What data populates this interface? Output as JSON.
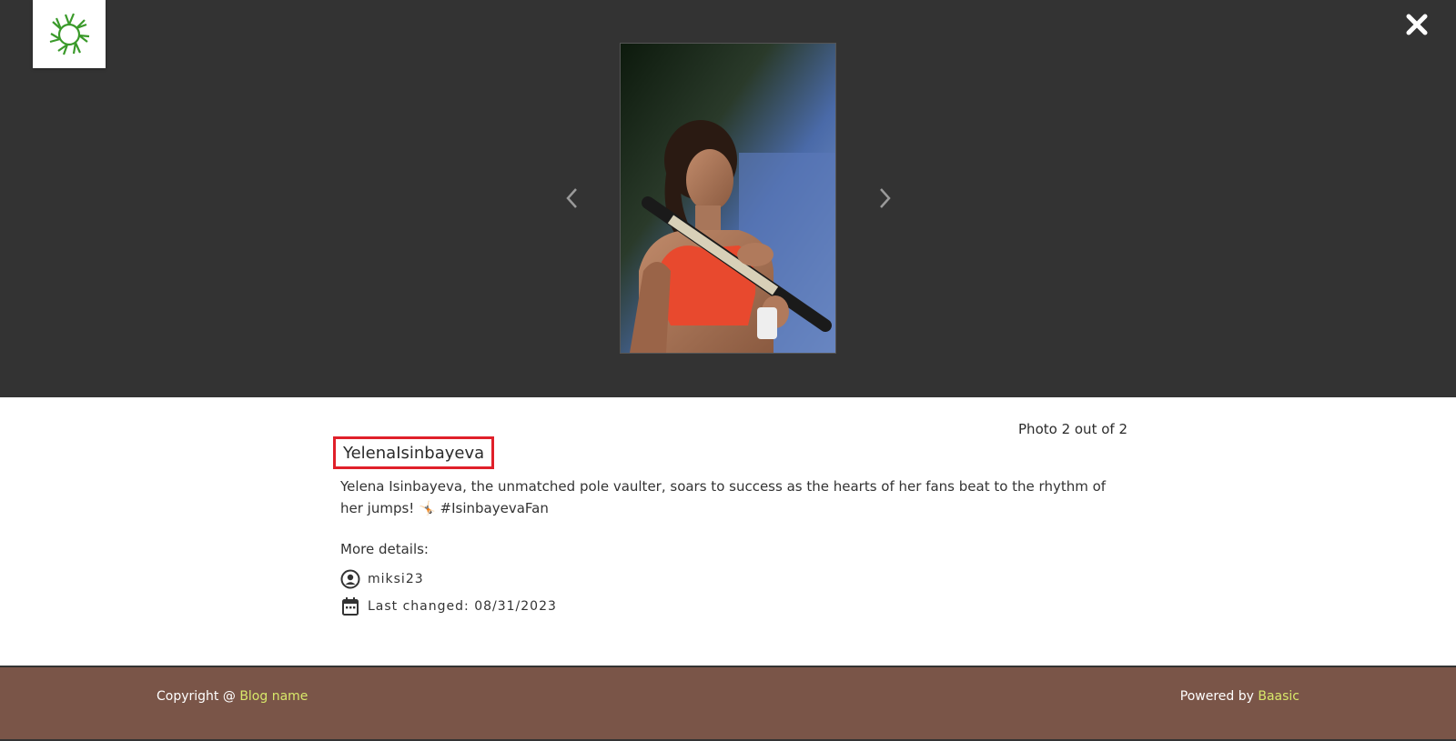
{
  "viewer": {
    "close_icon": "close-icon",
    "prev_icon": "chevron-left-icon",
    "next_icon": "chevron-right-icon",
    "logo_icon": "sun-logo-icon",
    "photo_alt": "Yelena Isinbayeva holding pole"
  },
  "details": {
    "counter": "Photo 2 out of 2",
    "title": "YelenaIsinbayeva",
    "description": "Yelena Isinbayeva, the unmatched pole vaulter, soars to success as the hearts of her fans beat to the rhythm of her jumps! 🤸🏻 #IsinbayevaFan",
    "more_label": "More details:",
    "author": "miksi23",
    "last_changed": "Last changed: 08/31/2023"
  },
  "footer": {
    "copyright_prefix": "Copyright @ ",
    "blog_link": "Blog name",
    "powered_prefix": "Powered by ",
    "powered_link": "Baasic"
  },
  "colors": {
    "viewer_bg": "#333333",
    "highlight_border": "#e0202a",
    "footer_bg": "#7a5548",
    "footer_link": "#d8e86a",
    "logo_green": "#3a9a2a"
  }
}
